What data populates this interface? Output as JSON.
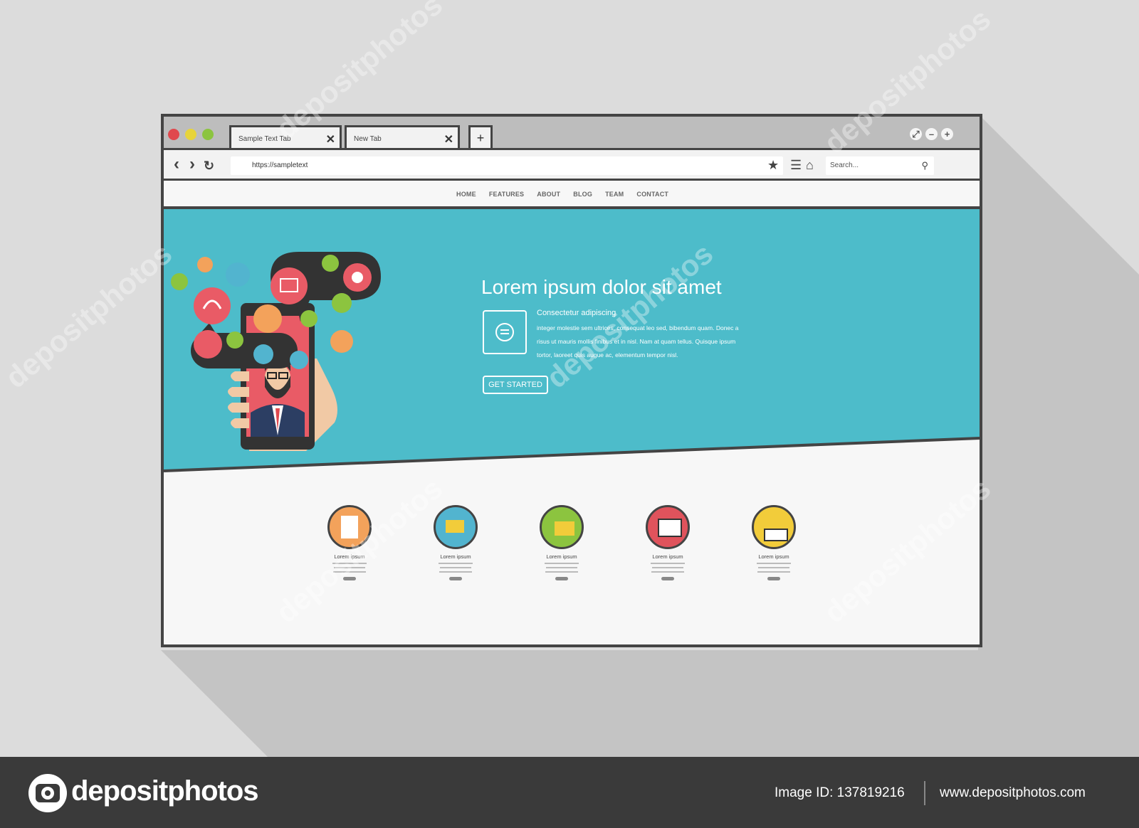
{
  "browser": {
    "tabs": [
      {
        "label": "Sample Text Tab",
        "close": "✕"
      },
      {
        "label": "New Tab",
        "close": "✕"
      }
    ],
    "new_tab": "+",
    "url": "https://sampletext",
    "search_placeholder": "Search...",
    "nav": {
      "back": "‹",
      "forward": "›",
      "reload": "↻"
    },
    "window_controls": {
      "restore": "⤢",
      "minimize": "–",
      "maximize": "+"
    },
    "traffic_lights": [
      "#e0484d",
      "#e7d43a",
      "#8cc43f"
    ]
  },
  "site": {
    "nav": [
      "HOME",
      "FEATURES",
      "ABOUT",
      "BLOG",
      "TEAM",
      "CONTACT"
    ],
    "hero": {
      "title": "Lorem ipsum dolor sit amet",
      "subtitle": "Consectetur adipiscing",
      "body": "integer molestie sem ultrices, consequat leo sed, bibendum quam. Donec a risus ut mauris mollis finibus et in nisl. Nam at quam tellus. Quisque ipsum tortor, laoreet quis augue ac, elementum tempor nisl.",
      "cta": "GET STARTED",
      "color": "#4dbcca"
    },
    "features": [
      {
        "label": "Lorem ipsum",
        "color": "#f3a25b",
        "icon": "document-search-icon"
      },
      {
        "label": "Lorem ipsum",
        "color": "#52b4cf",
        "icon": "mail-coffee-icon"
      },
      {
        "label": "Lorem ipsum",
        "color": "#8cc43f",
        "icon": "folder-calculator-icon"
      },
      {
        "label": "Lorem ipsum",
        "color": "#e0535c",
        "icon": "computer-idea-icon"
      },
      {
        "label": "Lorem ipsum",
        "color": "#f2cc3a",
        "icon": "books-apple-icon"
      }
    ]
  },
  "footer": {
    "brand": "depositphotos",
    "image_id": "Image ID: 137819216",
    "website": "www.depositphotos.com"
  },
  "watermark": "depositphotos"
}
